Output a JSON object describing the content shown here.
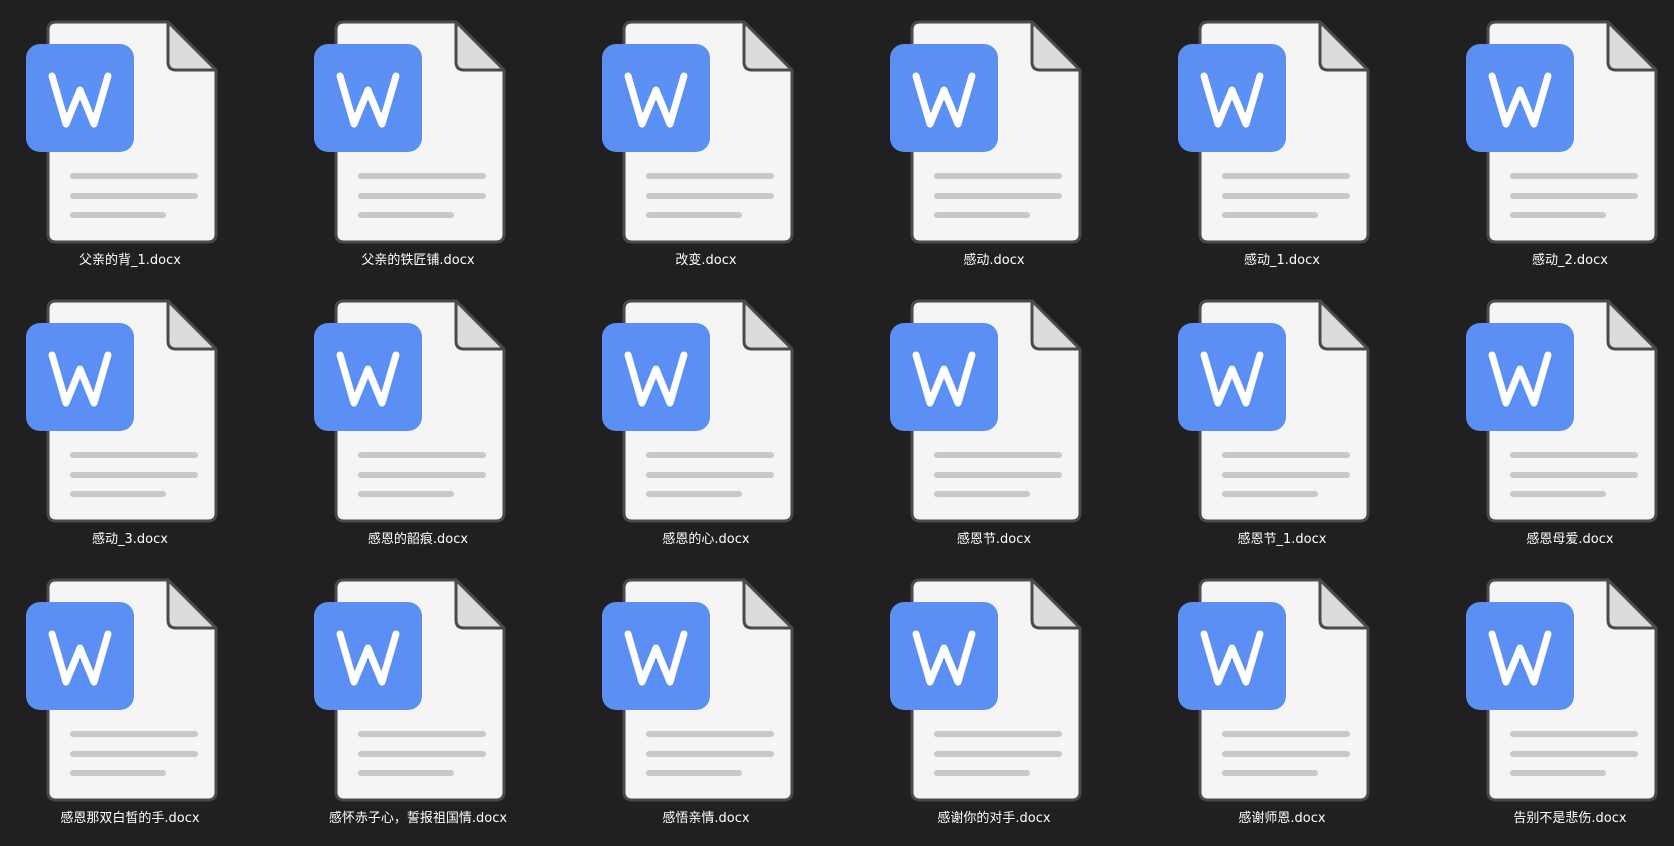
{
  "view": "file-grid",
  "icon": {
    "name": "word-document-icon",
    "badge_letter": "W",
    "badge_color": "#5B8FF3",
    "page_color": "#F5F5F5",
    "page_border_color": "#4A4A4A",
    "line_color": "#C8C8C8",
    "background_color": "#202020",
    "label_color": "#FFFFFF"
  },
  "files": [
    {
      "name": "父亲的背_1.docx"
    },
    {
      "name": "父亲的铁匠铺.docx"
    },
    {
      "name": "改变.docx"
    },
    {
      "name": "感动.docx"
    },
    {
      "name": "感动_1.docx"
    },
    {
      "name": "感动_2.docx"
    },
    {
      "name": "感动_3.docx"
    },
    {
      "name": "感恩的韶痕.docx"
    },
    {
      "name": "感恩的心.docx"
    },
    {
      "name": "感恩节.docx"
    },
    {
      "name": "感恩节_1.docx"
    },
    {
      "name": "感恩母爱.docx"
    },
    {
      "name": "感恩那双白皙的手.docx"
    },
    {
      "name": "感怀赤子心，誓报祖国情.docx"
    },
    {
      "name": "感悟亲情.docx"
    },
    {
      "name": "感谢你的对手.docx"
    },
    {
      "name": "感谢师恩.docx"
    },
    {
      "name": "告别不是悲伤.docx"
    }
  ]
}
